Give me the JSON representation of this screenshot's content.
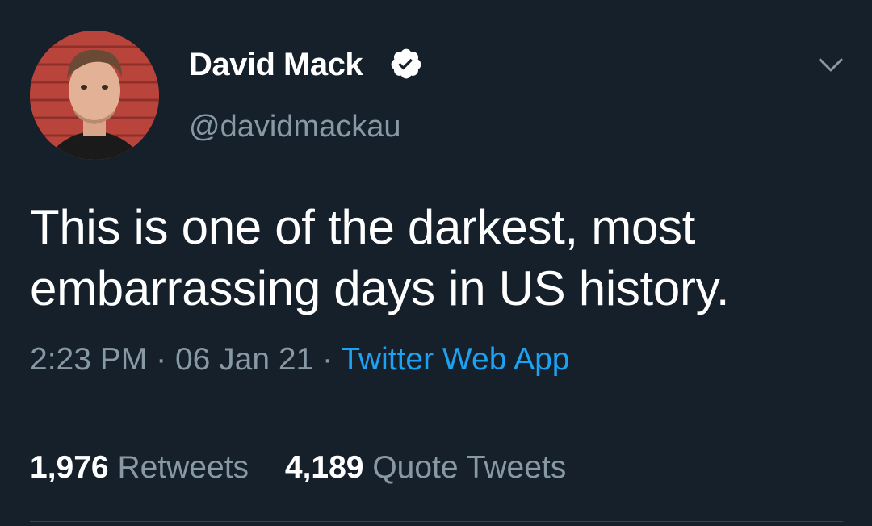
{
  "author": {
    "display_name": "David Mack",
    "handle": "@davidmackau",
    "verified": true,
    "avatar_icon": "avatar-photo"
  },
  "tweet": {
    "text_line1": "This is one of the darkest, most",
    "text_line2": "embarrassing days in US history.",
    "time": "2:23 PM",
    "separator": "·",
    "date": "06 Jan 21",
    "source": "Twitter Web App"
  },
  "stats": {
    "retweets_count": "1,976",
    "retweets_label": "Retweets",
    "quotes_count": "4,189",
    "quotes_label": "Quote Tweets"
  },
  "icons": {
    "menu": "chevron-down-icon",
    "verified": "verified-badge-icon"
  },
  "colors": {
    "background": "#15202b",
    "text": "#ffffff",
    "muted": "#8899a6",
    "link": "#1da1f2",
    "divider": "#38444d"
  }
}
